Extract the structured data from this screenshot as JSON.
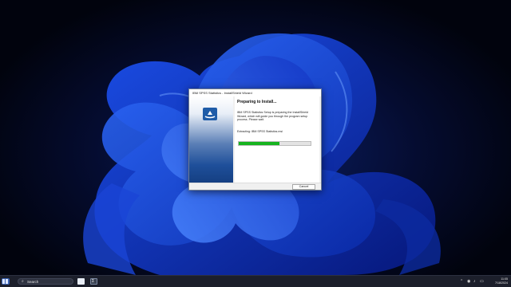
{
  "dialog": {
    "title": "IBM SPSS Statistics - InstallShield Wizard",
    "heading": "Preparing to Install...",
    "description": "IBM SPSS Statistics Setup is preparing the InstallShield Wizard, which will guide you through the program setup process. Please wait.",
    "status": "Extracting: IBM SPSS Statistics.msi",
    "progress_fraction": 0.57,
    "cancel_label": "Cancel",
    "accent_color": "#16b31f"
  },
  "taskbar": {
    "search_label": "Search",
    "clock_time": "11:05",
    "clock_date": "7/18/2024",
    "icons": [
      "start-icon",
      "search-icon",
      "file-explorer-icon",
      "terminal-icon",
      "chevron-up-icon",
      "network-icon",
      "volume-icon",
      "battery-icon"
    ]
  }
}
